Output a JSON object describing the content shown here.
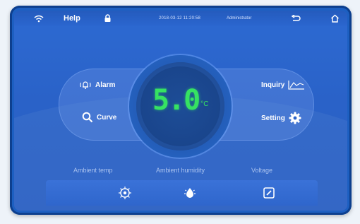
{
  "topbar": {
    "help_label": "Help",
    "datetime": "2018-03-12 11:20:58",
    "user": "Administrator",
    "icons": [
      "wifi-icon",
      "lock-icon",
      "back-icon",
      "home-icon"
    ]
  },
  "display": {
    "value": "5.0",
    "unit": "°C",
    "color": "#36e262"
  },
  "menu": {
    "alarm": "Alarm",
    "curve": "Curve",
    "inquiry": "Inquiry",
    "setting": "Setting"
  },
  "environment": {
    "temp_label": "Ambient temp",
    "humidity_label": "Ambient humidity",
    "voltage_label": "Voltage"
  },
  "colors": {
    "frame": "#1d5fc1",
    "screen": "#2a62c8",
    "accent_green": "#36e262"
  }
}
